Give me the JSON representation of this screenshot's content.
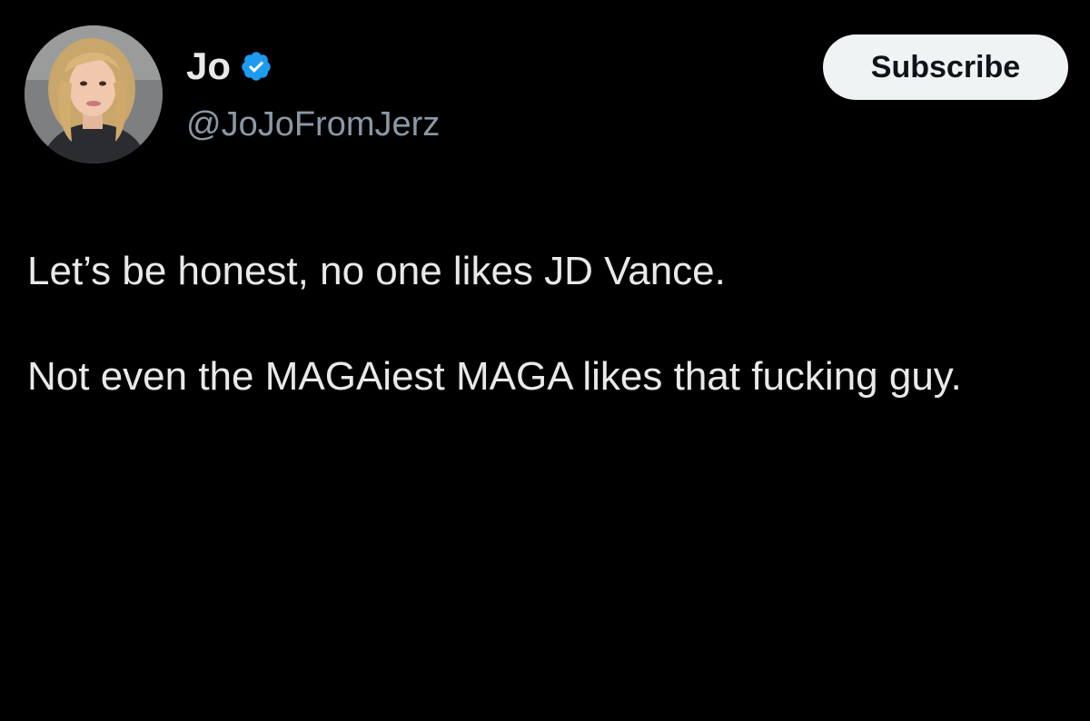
{
  "author": {
    "display_name": "Jo",
    "handle": "@JoJoFromJerz",
    "verified": true,
    "avatar_icon": "profile-photo"
  },
  "actions": {
    "subscribe_label": "Subscribe"
  },
  "tweet": {
    "paragraph_1": "Let’s be honest, no one likes JD Vance.",
    "paragraph_2": "Not even the MAGAiest MAGA likes that fucking guy."
  },
  "colors": {
    "background": "#000000",
    "text_primary": "#e7e9ea",
    "text_secondary": "#8b98a5",
    "verified_badge": "#1d9bf0",
    "subscribe_bg": "#eff3f4",
    "subscribe_text": "#0f1419"
  }
}
